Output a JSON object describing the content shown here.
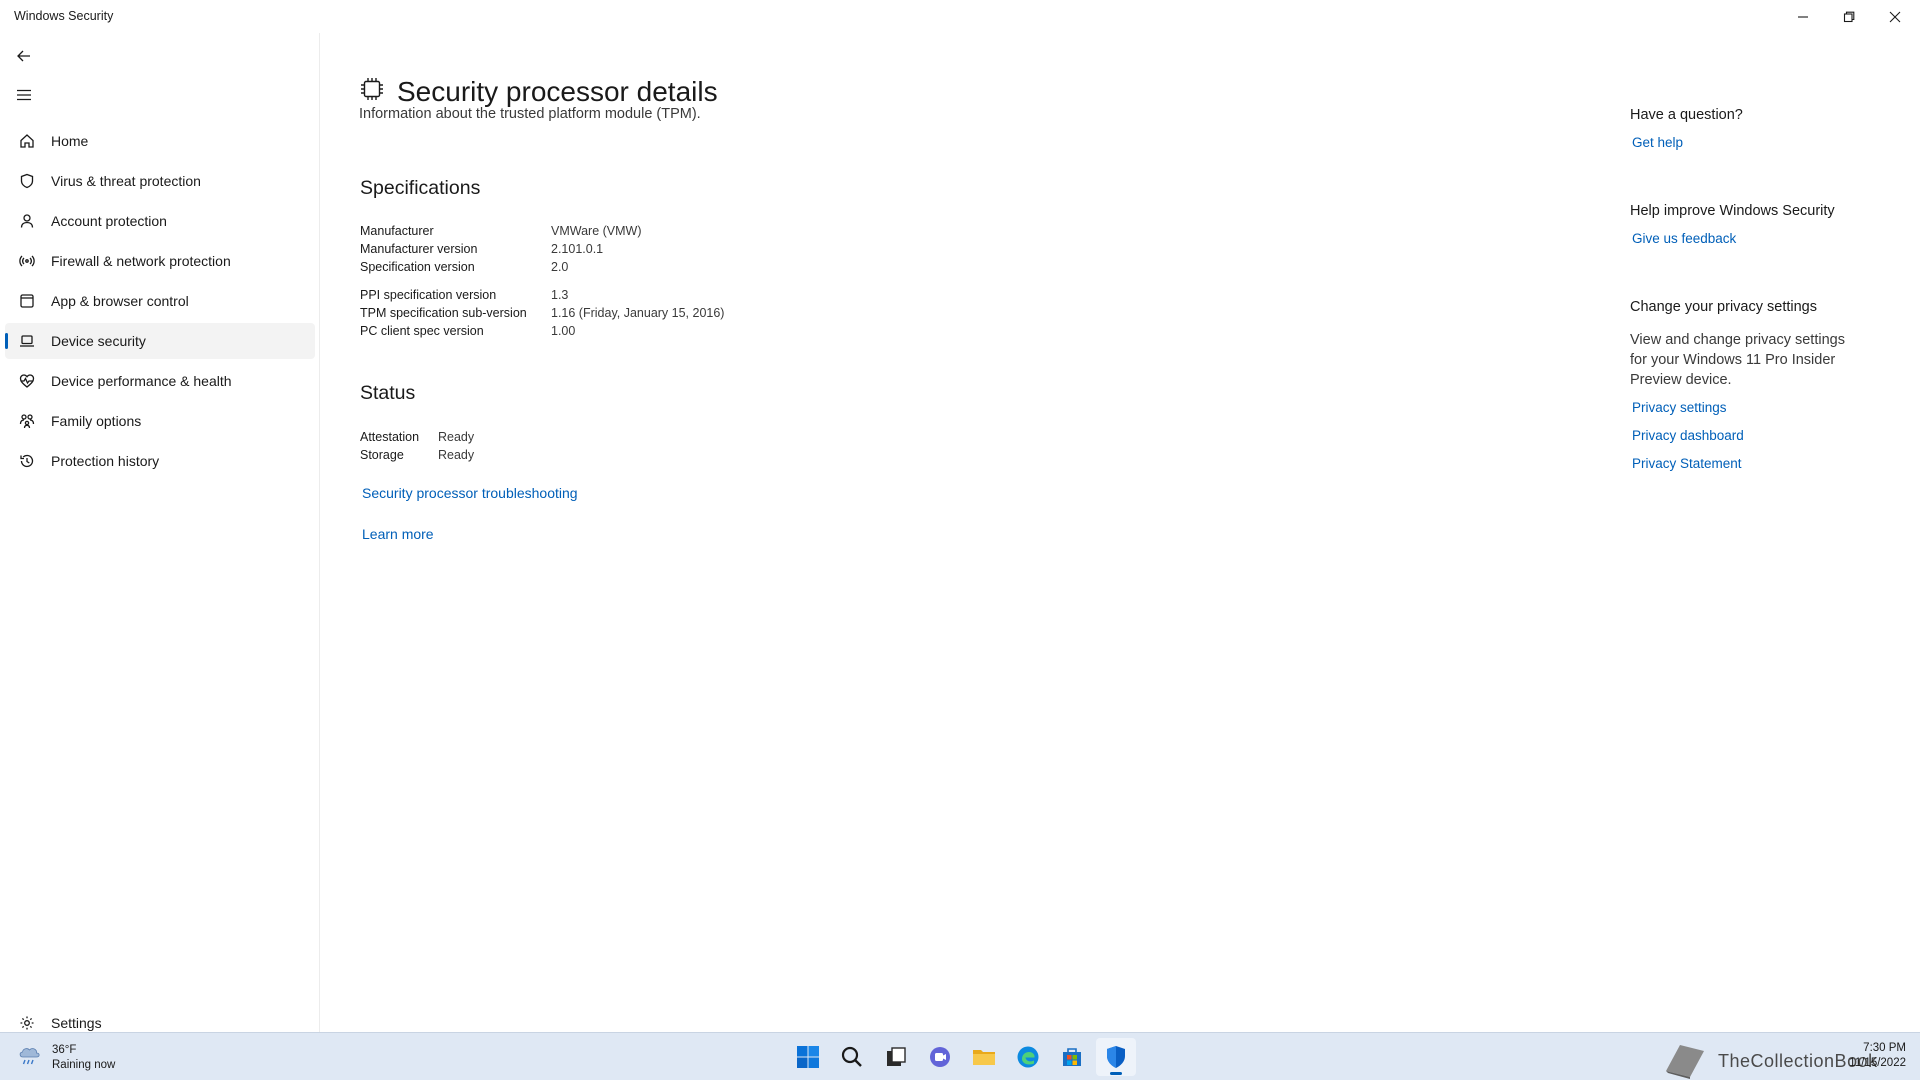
{
  "window": {
    "title": "Windows Security",
    "minimize_icon": "minimize-icon",
    "restore_icon": "restore-icon",
    "close_icon": "close-icon"
  },
  "sidebar": {
    "back_icon": "back-arrow-icon",
    "menu_icon": "hamburger-menu-icon",
    "items": [
      {
        "label": "Home",
        "icon": "home-icon"
      },
      {
        "label": "Virus & threat protection",
        "icon": "shield-icon"
      },
      {
        "label": "Account protection",
        "icon": "person-icon"
      },
      {
        "label": "Firewall & network protection",
        "icon": "wifi-antenna-icon"
      },
      {
        "label": "App & browser control",
        "icon": "app-window-icon"
      },
      {
        "label": "Device security",
        "icon": "laptop-icon",
        "active": true
      },
      {
        "label": "Device performance & health",
        "icon": "heart-pulse-icon"
      },
      {
        "label": "Family options",
        "icon": "family-icon"
      },
      {
        "label": "Protection history",
        "icon": "history-icon"
      }
    ],
    "settings": {
      "label": "Settings",
      "icon": "gear-icon"
    }
  },
  "main": {
    "title": "Security processor details",
    "title_icon": "chip-icon",
    "description": "Information about the trusted platform module (TPM).",
    "specifications": {
      "heading": "Specifications",
      "rows": [
        {
          "key": "Manufacturer",
          "value": "VMWare (VMW)"
        },
        {
          "key": "Manufacturer version",
          "value": "2.101.0.1"
        },
        {
          "key": "Specification version",
          "value": "2.0"
        },
        {
          "key": "PPI specification version",
          "value": "1.3"
        },
        {
          "key": "TPM specification sub-version",
          "value": "1.16 (Friday, January 15, 2016)"
        },
        {
          "key": "PC client spec version",
          "value": "1.00"
        }
      ]
    },
    "status": {
      "heading": "Status",
      "rows": [
        {
          "key": "Attestation",
          "value": "Ready"
        },
        {
          "key": "Storage",
          "value": "Ready"
        }
      ]
    },
    "troubleshoot_link": "Security processor troubleshooting",
    "learn_more_link": "Learn more"
  },
  "right_panel": {
    "question_heading": "Have a question?",
    "get_help": "Get help",
    "improve_heading": "Help improve Windows Security",
    "feedback": "Give us feedback",
    "privacy_heading": "Change your privacy settings",
    "privacy_text": "View and change privacy settings for your Windows 11 Pro Insider Preview device.",
    "privacy_settings": "Privacy settings",
    "privacy_dashboard": "Privacy dashboard",
    "privacy_statement": "Privacy Statement"
  },
  "taskbar": {
    "weather_temp": "36°F",
    "weather_desc": "Raining now",
    "apps": [
      {
        "name": "start-icon"
      },
      {
        "name": "search-icon"
      },
      {
        "name": "task-view-icon"
      },
      {
        "name": "teams-chat-icon"
      },
      {
        "name": "file-explorer-icon"
      },
      {
        "name": "edge-icon"
      },
      {
        "name": "store-icon"
      },
      {
        "name": "windows-security-icon",
        "active": true
      }
    ],
    "watermark": "TheCollectionBook",
    "time": "7:30 PM",
    "date": "11/15/2022"
  },
  "colors": {
    "accent": "#005fb8",
    "taskbar": "#dfe8f4",
    "active_nav": "#f3f3f3"
  }
}
